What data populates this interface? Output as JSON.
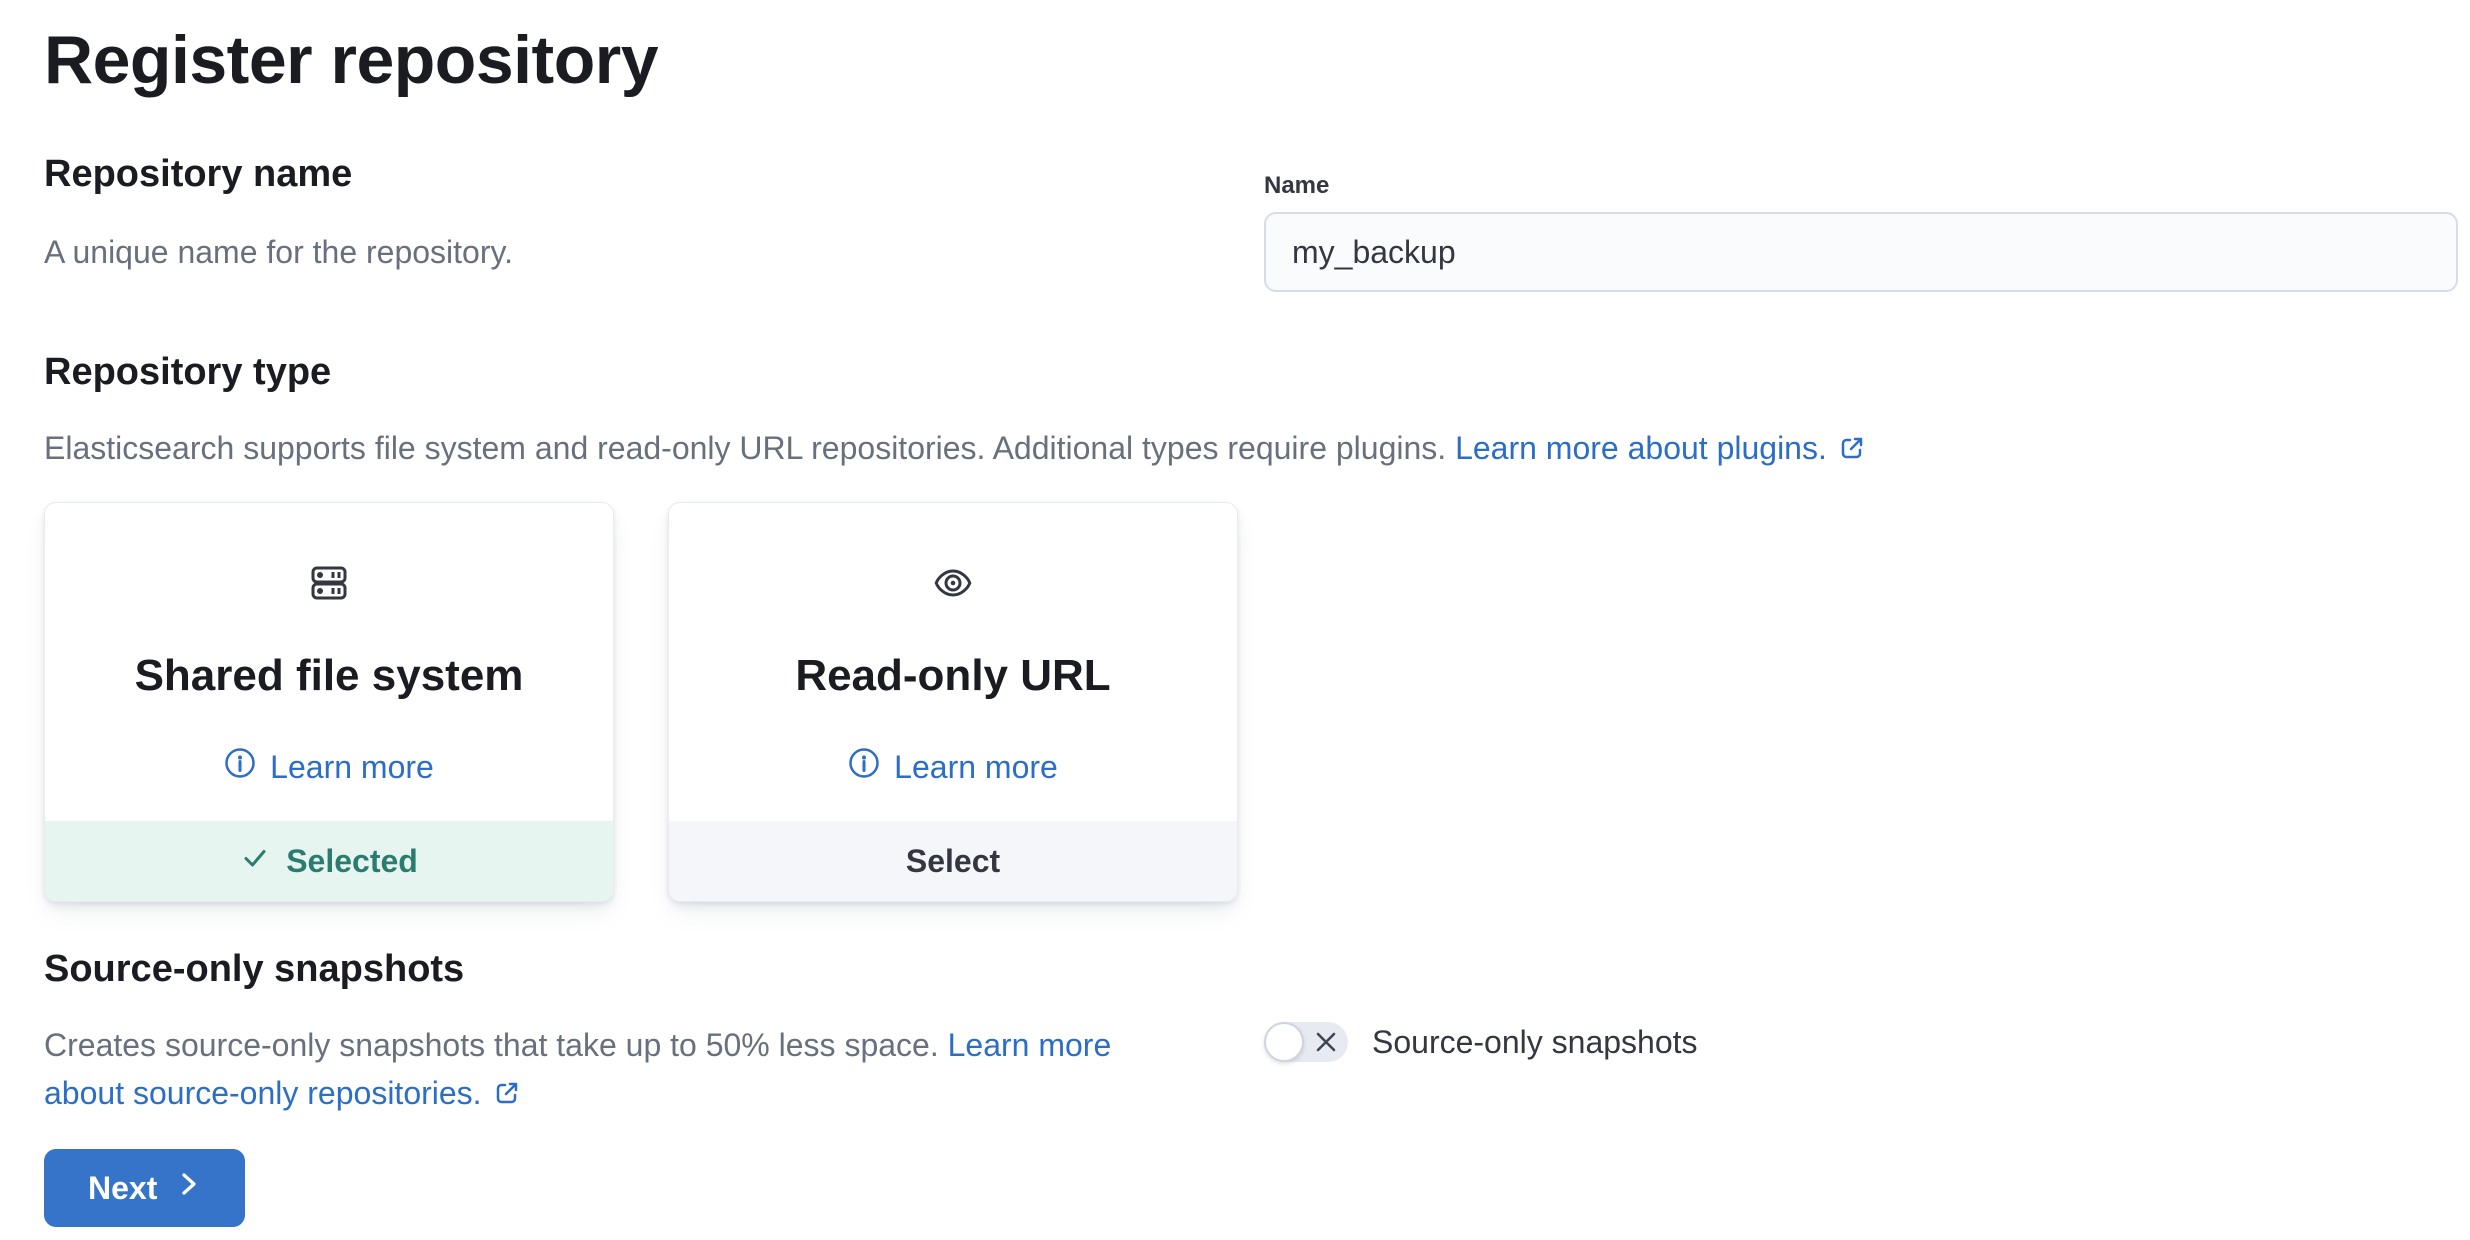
{
  "page": {
    "title": "Register repository"
  },
  "name_section": {
    "heading": "Repository name",
    "description": "A unique name for the repository.",
    "field_label": "Name",
    "field_value": "my_backup"
  },
  "type_section": {
    "heading": "Repository type",
    "description": "Elasticsearch supports file system and read-only URL repositories. Additional types require plugins.",
    "link_label": "Learn more about plugins.",
    "cards": [
      {
        "title": "Shared file system",
        "icon": "storage-icon",
        "learn_more_label": "Learn more",
        "footer_label": "Selected",
        "state": "selected"
      },
      {
        "title": "Read-only URL",
        "icon": "eye-icon",
        "learn_more_label": "Learn more",
        "footer_label": "Select",
        "state": "unselected"
      }
    ]
  },
  "source_section": {
    "heading": "Source-only snapshots",
    "description": "Creates source-only snapshots that take up to 50% less space.",
    "link_label": "Learn more about source-only repositories.",
    "toggle_label": "Source-only snapshots",
    "toggle_state": "off"
  },
  "actions": {
    "next_label": "Next"
  },
  "colors": {
    "primary_button": "#3574c8",
    "link": "#2c6ec6",
    "success_text": "#2b7c6f",
    "success_bg": "#e6f5f0",
    "neutral_footer_bg": "#f5f6fa",
    "heading_text": "#1a1c21",
    "body_text": "#343741",
    "subdued_text": "#69707d"
  }
}
